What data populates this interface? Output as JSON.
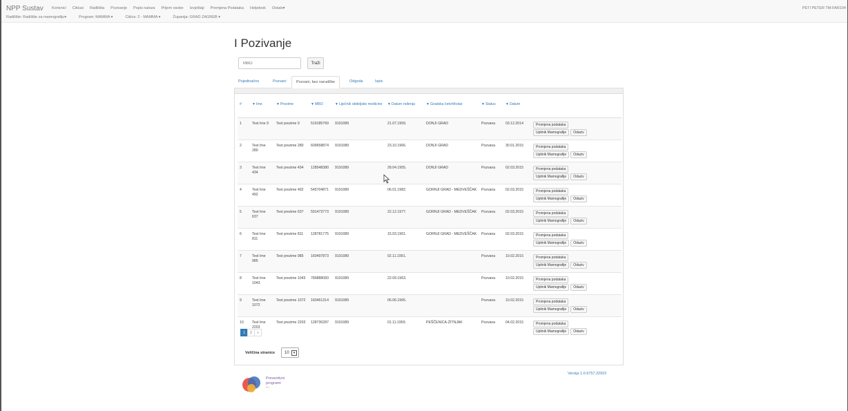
{
  "navbar": {
    "brand": "NPP Sustav",
    "items": [
      "Korisnici",
      "Ciklusi",
      "Radilišta",
      "Pozivanje",
      "Popis naloza",
      "Prijem osobe",
      "Izvještaji",
      "Promjena Podataka",
      "Helpdesk",
      "Ostalo▾"
    ],
    "filters": [
      "Radilište: Radilište za mamografiju▾",
      "Program: MAMMA ▾",
      "Ciklus: 2 - MAMMA ▾",
      "Županija: GRAD ZAGREB ▾"
    ],
    "user": "PETI PETER TM-FAR104"
  },
  "page": {
    "title": "I Pozivanje",
    "search_placeholder": "MBO",
    "search_button": "Traži"
  },
  "tabs": [
    "Pojedinačno",
    "Pozvani",
    "Pozvani, bez narudžbe",
    "Odgoda",
    "Ispis"
  ],
  "active_tab": 2,
  "table": {
    "headers": [
      "#",
      "Ime",
      "Prezime",
      "MBO",
      "Liječnik obiteljske medicine",
      "Datum rođenja",
      "Gradska četvrt/kotar",
      "Status",
      "Datum"
    ],
    "rows": [
      {
        "n": "1",
        "ime": "Test Ime 9",
        "prezime": "Test prezime 9",
        "mbo": "519185769",
        "lijecnik": "9191089",
        "rodjenje": "21.07.1959.",
        "cetvrt": "DONJI GRAD",
        "status": "Pozvana",
        "datum": "03.12.2014"
      },
      {
        "n": "2",
        "ime": "Test Ime 280",
        "prezime": "Test prezime 280",
        "mbo": "609658874",
        "lijecnik": "9191089",
        "rodjenje": "23.10.1966.",
        "cetvrt": "DONJI GRAD",
        "status": "Pozvana",
        "datum": "30.01.2015"
      },
      {
        "n": "3",
        "ime": "Test Ime 434",
        "prezime": "Test prezime 434",
        "mbo": "128548380",
        "lijecnik": "9191089",
        "rodjenje": "28.04.1955.",
        "cetvrt": "DONJI GRAD",
        "status": "Pozvana",
        "datum": "02.03.2015"
      },
      {
        "n": "4",
        "ime": "Test Ime 492",
        "prezime": "Test prezime 492",
        "mbo": "545704871",
        "lijecnik": "9191089",
        "rodjenje": "06.01.1982.",
        "cetvrt": "GORNJI GRAD - MEDVEŠČAK",
        "status": "Pozvana",
        "datum": "02.03.2015"
      },
      {
        "n": "5",
        "ime": "Test Ime 637",
        "prezime": "Test prezime 637",
        "mbo": "591473773",
        "lijecnik": "9191089",
        "rodjenje": "22.12.1977.",
        "cetvrt": "GORNJI GRAD - MEDVEŠČAK",
        "status": "Pozvana",
        "datum": "02.03.2015"
      },
      {
        "n": "6",
        "ime": "Test Ime 811",
        "prezime": "Test prezime 811",
        "mbo": "128781775",
        "lijecnik": "9191089",
        "rodjenje": "15.03.1961.",
        "cetvrt": "GORNJI GRAD - MEDVEŠČAK",
        "status": "Pozvana",
        "datum": "02.03.2015"
      },
      {
        "n": "7",
        "ime": "Test Ime 985",
        "prezime": "Test prezime 985",
        "mbo": "160497873",
        "lijecnik": "9191089",
        "rodjenje": "02.11.1991.",
        "cetvrt": "",
        "status": "Pozvana",
        "datum": "10.02.2015"
      },
      {
        "n": "8",
        "ime": "Test Ime 1043",
        "prezime": "Test prezime 1043",
        "mbo": "789888083",
        "lijecnik": "9191089",
        "rodjenje": "22.09.1963.",
        "cetvrt": "",
        "status": "Pozvana",
        "datum": "10.02.2015"
      },
      {
        "n": "9",
        "ime": "Test Ime 1072",
        "prezime": "Test prezime 1072",
        "mbo": "160461314",
        "lijecnik": "9191089",
        "rodjenje": "06.06.1965.",
        "cetvrt": "",
        "status": "Pozvana",
        "datum": "10.02.2015"
      },
      {
        "n": "10",
        "ime": "Test Ime 2203",
        "prezime": "Test prezime 2203",
        "mbo": "128730287",
        "lijecnik": "9191089",
        "rodjenje": "01.11.1959.",
        "cetvrt": "PEŠČENICA-ŽITNJAK",
        "status": "Pozvana",
        "datum": "04.02.2015"
      }
    ],
    "actions": {
      "edit": "Promjena podataka",
      "questionnaire": "Upitnik Mamografije",
      "response": "Odaziv"
    }
  },
  "pagination": {
    "pages": [
      "1",
      "2",
      "»"
    ],
    "active": "1"
  },
  "page_size": {
    "label": "Veličina stranice",
    "value": "10"
  },
  "footer": {
    "version": "Verzija 1.0.6757.22922",
    "logo_line1": "Preventivni",
    "logo_line2": "programi",
    "logo_line3": "RH"
  },
  "colors": {
    "link": "#337ab7",
    "navbar_bg": "#f8f8f8",
    "active_page": "#337ab7"
  }
}
